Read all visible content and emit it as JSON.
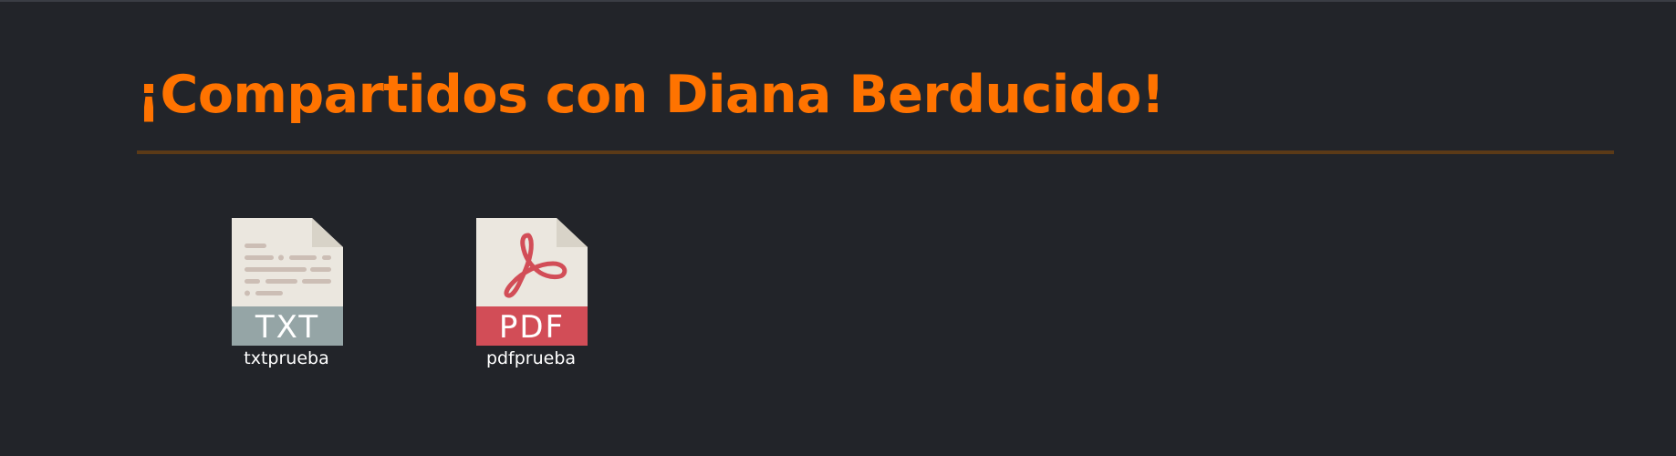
{
  "header": {
    "title": "¡Compartidos con Diana Berducido!"
  },
  "files": [
    {
      "name": "txtprueba",
      "type_label": "TXT",
      "icon": "txt-file-icon",
      "badge_color": "#95a5a6"
    },
    {
      "name": "pdfprueba",
      "type_label": "PDF",
      "icon": "pdf-file-icon",
      "badge_color": "#d24d57"
    }
  ],
  "colors": {
    "background": "#222429",
    "title": "#ff7300",
    "divider": "#5b3a17",
    "file_label": "#ffffff",
    "document_paper": "#ebe7df",
    "document_fold": "#d8d3c8"
  }
}
